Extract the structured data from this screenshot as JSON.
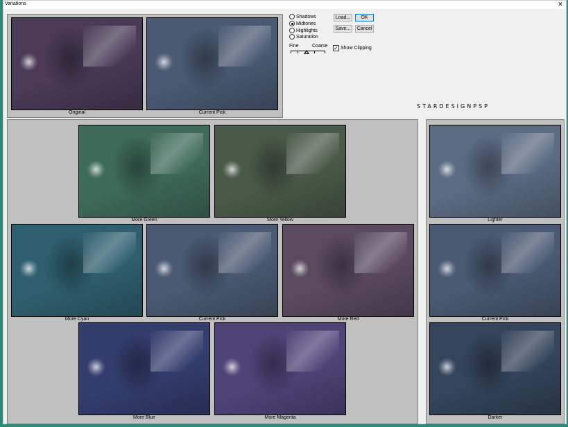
{
  "window": {
    "title": "Variations",
    "close_symbol": "✕"
  },
  "adjust": {
    "options": [
      {
        "label": "Shadows",
        "selected": false
      },
      {
        "label": "Midtones",
        "selected": true
      },
      {
        "label": "Highlights",
        "selected": false
      },
      {
        "label": "Saturation",
        "selected": false
      }
    ]
  },
  "buttons": {
    "load": "Load...",
    "save": "Save...",
    "ok": "OK",
    "cancel": "Cancel"
  },
  "slider": {
    "fine_label": "Fine",
    "coarse_label": "Coarse"
  },
  "show_clipping": {
    "label": "Show Clipping",
    "checked": true,
    "mark": "✓"
  },
  "watermark": "STARDESIGNPSP",
  "top_thumbs": {
    "original": "Original",
    "current_pick": "Current Pick"
  },
  "color_thumbs": {
    "more_green": "More Green",
    "more_yellow": "More Yellow",
    "more_cyan": "More Cyan",
    "current_pick": "Current Pick",
    "more_red": "More Red",
    "more_blue": "More Blue",
    "more_magenta": "More Magenta"
  },
  "light_thumbs": {
    "lighter": "Lighter",
    "current_pick": "Current Pick",
    "darker": "Darker"
  },
  "colors": {
    "original": "#4a3a55",
    "current_pick": "#4a5a72",
    "more_green": "#3e6a5a",
    "more_yellow": "#4a5a48",
    "more_cyan": "#2f5f6e",
    "more_red": "#5a4a60",
    "more_blue": "#333d6e",
    "more_magenta": "#4e4478",
    "lighter": "#5b6b82",
    "darker": "#34445a"
  }
}
